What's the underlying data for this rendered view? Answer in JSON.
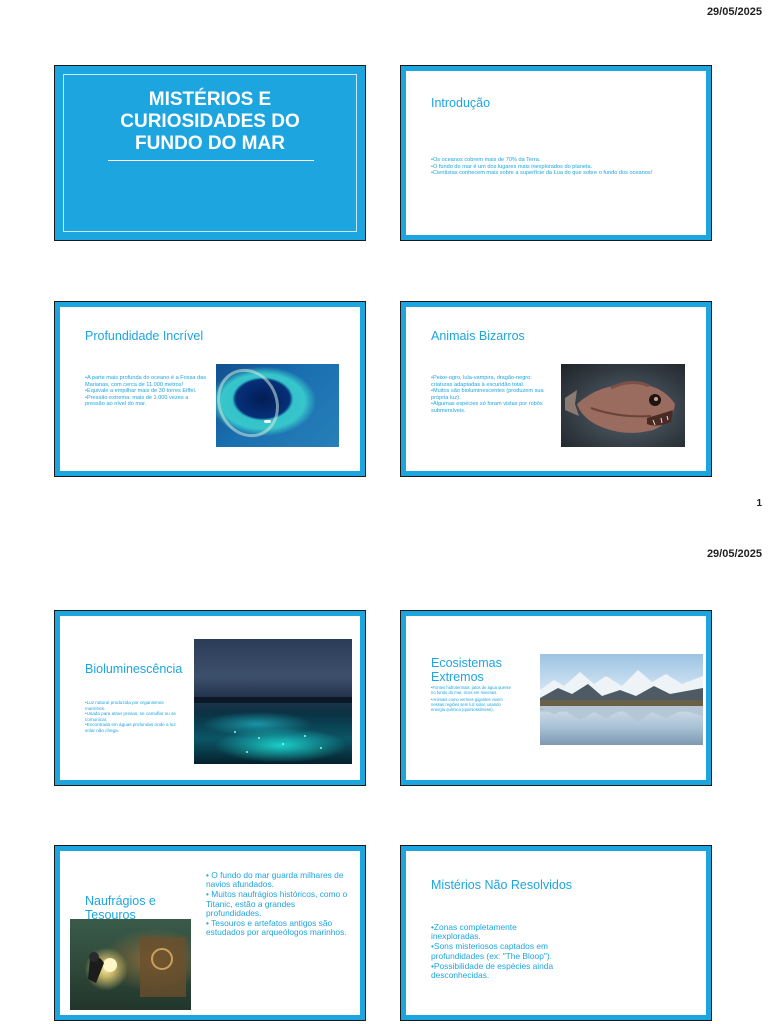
{
  "date": "29/05/2025",
  "page_number": "1",
  "slides": {
    "title": {
      "lines": [
        "MISTÉRIOS E",
        "CURIOSIDADES DO",
        "FUNDO DO MAR"
      ]
    },
    "introducao": {
      "heading": "Introdução",
      "bullets": [
        "•Os oceanos cobrem mais de 70% da Terra.",
        "•O fundo do mar é um dos lugares mais inexplorados do planeta.",
        "•Cientistas conhecem mais sobre a superfície da Lua do que sobre o fundo dos oceanos!"
      ]
    },
    "profundidade": {
      "heading": "Profundidade Incrível",
      "bullets": [
        "•A parte mais profunda do oceano é a Fossa das Marianas, com cerca de 11.000 metros!",
        "•Equivale a empilhar mais de 30 torres Eiffel.",
        "•Pressão extrema: mais de 1.000 vezes a pressão ao nível do mar."
      ]
    },
    "animais": {
      "heading": "Animais Bizarros",
      "bullets": [
        "•Peixe-ogro, lula-vampira, dragão-negro: criaturas adaptadas à escuridão total.",
        "•Muitos são bioluminescentes (produzem sua própria luz).",
        "•Algumas espécies só foram vistas por robôs submersíveis."
      ]
    },
    "bioluminescencia": {
      "heading": "Bioluminescência",
      "bullets": [
        "•Luz natural produzida por organismos marinhos.",
        "•Usada para atrair presas, se camuflar ou se comunicar.",
        "•Encontrada em águas profundas onde a luz solar não chega."
      ]
    },
    "ecossistemas": {
      "heading_lines": [
        "Ecosistemas",
        "Extremos"
      ],
      "bullets": [
        "•Fontes hidrotermais: jatos de água quente no fundo do mar, ricos em minerais.",
        "•Animais como vermes gigantes vivem nessas regiões sem luz solar, usando energia química (quimiossíntese)."
      ]
    },
    "naufragios": {
      "heading_lines": [
        "Naufrágios e",
        "Tesouros"
      ],
      "bullets": [
        "• O fundo do mar guarda milhares de navios afundados.",
        "• Muitos naufrágios históricos, como o Titanic, estão a grandes profundidades.",
        "• Tesouros e artefatos antigos são estudados por arqueólogos marinhos."
      ]
    },
    "misterios": {
      "heading": "Mistérios Não Resolvidos",
      "bullets": [
        "•Zonas completamente inexploradas.",
        "•Sons misteriosos captados em profundidades (ex: \"The Bloop\").",
        "•Possibilidade de espécies ainda desconhecidas."
      ]
    }
  },
  "colors": {
    "accent": "#1da5e0",
    "border": "#1a1a1a"
  },
  "icons": {
    "blue-hole-photo": "aerial-reef-sinkhole",
    "fangtooth-photo": "deep-sea-fish",
    "bioluminescence-photo": "glowing-shoreline-night",
    "arctic-photo": "snowy-mountains-lake",
    "shipwreck-photo": "diver-shipwreck"
  }
}
